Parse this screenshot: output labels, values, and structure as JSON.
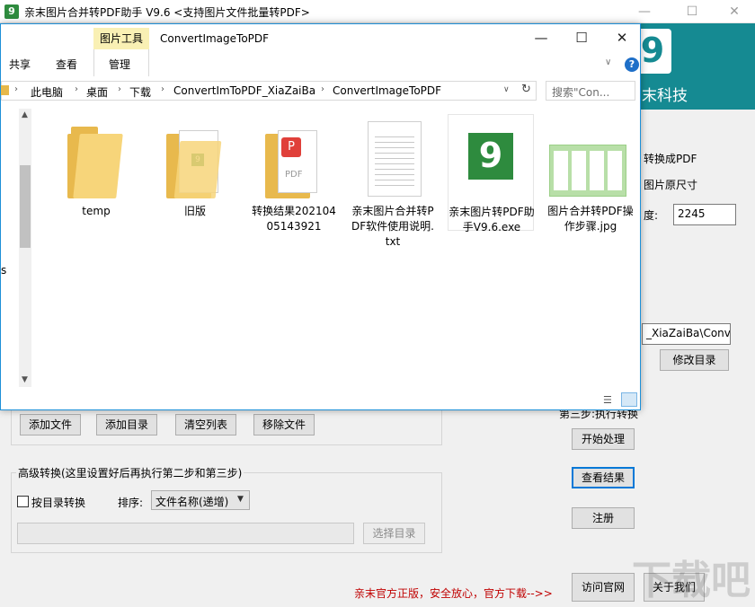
{
  "app": {
    "title": "亲末图片合并转PDF助手 V9.6  <支持图片文件批量转PDF>",
    "logo_glyph": "9",
    "brand_text": "末科技",
    "step2_opts": {
      "convert_pdf": "转换成PDF",
      "orig_size": "图片原尺寸",
      "height_label": "度:",
      "height_value": "2245"
    },
    "output_path": "_XiaZaiBa\\Conver",
    "modify_dir_button": "修改目录",
    "file_buttons": [
      "添加文件",
      "添加目录",
      "清空列表",
      "移除文件"
    ],
    "step3_label": "第三步:执行转换",
    "start_button": "开始处理",
    "view_result_button": "查看结果",
    "register_button": "注册",
    "advanced": {
      "title": "高级转换(这里设置好后再执行第二步和第三步)",
      "dir_convert_label": "按目录转换",
      "sort_label": "排序:",
      "sort_value": "文件名称(递增)",
      "select_dir_button": "选择目录"
    },
    "footer_link": "亲末官方正版，安全放心，官方下载-->>",
    "visit_site_button": "访问官网",
    "about_button": "关于我们",
    "watermark": "下载吧"
  },
  "explorer": {
    "title": "ConvertImageToPDF",
    "context_tab": "图片工具",
    "ribbon_tabs": [
      "共享",
      "查看",
      "管理"
    ],
    "controls": {
      "minimize": "—",
      "maximize": "☐",
      "close": "✕"
    },
    "breadcrumb": [
      "此电脑",
      "桌面",
      "下载",
      "ConvertImToPDF_XiaZaiBa",
      "ConvertImageToPDF"
    ],
    "search_placeholder": "搜索\"Con...",
    "files": [
      {
        "label": "temp",
        "type": "folder"
      },
      {
        "label": "旧版",
        "type": "folder-app"
      },
      {
        "label": "转换结果20210405143921",
        "type": "folder-pdf"
      },
      {
        "label": "亲末图片合并转PDF软件使用说明.txt",
        "type": "txt"
      },
      {
        "label": "亲末图片转PDF助手V9.6.exe",
        "type": "exe"
      },
      {
        "label": "图片合并转PDF操作步骤.jpg",
        "type": "jpg"
      }
    ],
    "nav_text_fragment": "s"
  },
  "colors": {
    "banner": "#158a92",
    "brand_green": "#2e8b3e",
    "context_tab": "#f9f0b4",
    "footer_link": "#c00000",
    "explorer_border": "#1e90d8"
  }
}
